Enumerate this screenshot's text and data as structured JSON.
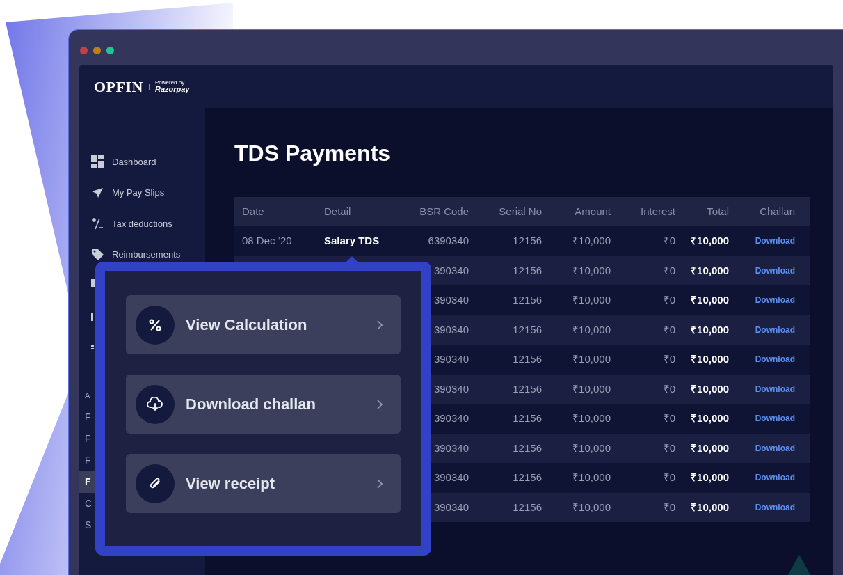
{
  "brand": {
    "name": "OPFIN",
    "powered_by": "Powered by",
    "partner": "Razorpay"
  },
  "sidebar": {
    "items": [
      {
        "kind": "link",
        "label": "Dashboard",
        "selected": false
      },
      {
        "kind": "link",
        "label": "My Pay Slips",
        "selected": false
      },
      {
        "kind": "link",
        "label": "Tax deductions",
        "selected": false
      },
      {
        "kind": "link",
        "label": "Reimbursements",
        "selected": false
      },
      {
        "kind": "icon",
        "selected": false
      },
      {
        "kind": "icon",
        "selected": false
      },
      {
        "kind": "icon",
        "selected": false
      }
    ],
    "section": {
      "heading": "A",
      "items": [
        {
          "label": "F",
          "selected": false
        },
        {
          "label": "F",
          "selected": false
        },
        {
          "label": "F",
          "selected": false
        },
        {
          "label": "F",
          "selected": true
        },
        {
          "label": "C",
          "selected": false
        },
        {
          "label": "S",
          "selected": false
        }
      ]
    }
  },
  "page_title": "TDS Payments",
  "table": {
    "columns": [
      "Date",
      "Detail",
      "BSR Code",
      "Serial No",
      "Amount",
      "Interest",
      "Total",
      "Challan"
    ],
    "rows": [
      {
        "date": "08 Dec ‘20",
        "detail": "Salary TDS",
        "bsr_code": "6390340",
        "serial_no": "12156",
        "amount": "₹10,000",
        "interest": "₹0",
        "total": "₹10,000",
        "challan": "Download"
      },
      {
        "bsr_code": "390340",
        "serial_no": "12156",
        "amount": "₹10,000",
        "interest": "₹0",
        "total": "₹10,000",
        "challan": "Download"
      },
      {
        "bsr_code": "390340",
        "serial_no": "12156",
        "amount": "₹10,000",
        "interest": "₹0",
        "total": "₹10,000",
        "challan": "Download"
      },
      {
        "bsr_code": "390340",
        "serial_no": "12156",
        "amount": "₹10,000",
        "interest": "₹0",
        "total": "₹10,000",
        "challan": "Download"
      },
      {
        "bsr_code": "390340",
        "serial_no": "12156",
        "amount": "₹10,000",
        "interest": "₹0",
        "total": "₹10,000",
        "challan": "Download"
      },
      {
        "bsr_code": "390340",
        "serial_no": "12156",
        "amount": "₹10,000",
        "interest": "₹0",
        "total": "₹10,000",
        "challan": "Download"
      },
      {
        "bsr_code": "390340",
        "serial_no": "12156",
        "amount": "₹10,000",
        "interest": "₹0",
        "total": "₹10,000",
        "challan": "Download"
      },
      {
        "bsr_code": "390340",
        "serial_no": "12156",
        "amount": "₹10,000",
        "interest": "₹0",
        "total": "₹10,000",
        "challan": "Download"
      },
      {
        "bsr_code": "390340",
        "serial_no": "12156",
        "amount": "₹10,000",
        "interest": "₹0",
        "total": "₹10,000",
        "challan": "Download"
      },
      {
        "bsr_code": "390340",
        "serial_no": "12156",
        "amount": "₹10,000",
        "interest": "₹0",
        "total": "₹10,000",
        "challan": "Download"
      }
    ]
  },
  "popup": {
    "actions": [
      {
        "label": "View Calculation"
      },
      {
        "label": "Download challan"
      },
      {
        "label": "View receipt"
      }
    ]
  }
}
